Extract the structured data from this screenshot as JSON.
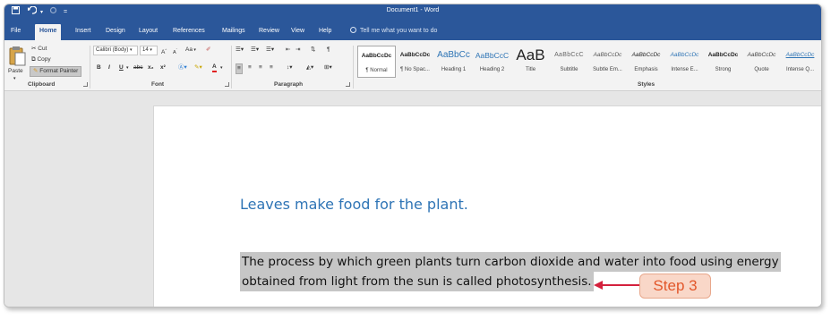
{
  "app": {
    "title": "Document1 - Word",
    "quick_access": {
      "save_icon": "save-icon",
      "undo_icon": "undo-icon",
      "redo_icon": "redo-icon",
      "customize_icon": "customize-icon"
    }
  },
  "tabs": [
    "File",
    "Home",
    "Insert",
    "Design",
    "Layout",
    "References",
    "Mailings",
    "Review",
    "View",
    "Help"
  ],
  "active_tab": "Home",
  "tell_me": "Tell me what you want to do",
  "ribbon": {
    "clipboard": {
      "label": "Clipboard",
      "paste": "Paste",
      "cut": "Cut",
      "copy": "Copy",
      "format_painter": "Format Painter"
    },
    "font": {
      "label": "Font",
      "font_name": "Calibri (Body)",
      "font_size": "14",
      "aa": "Aa",
      "buttons": [
        "B",
        "I",
        "U",
        "abc",
        "x₂",
        "x²"
      ]
    },
    "paragraph": {
      "label": "Paragraph"
    },
    "styles": {
      "label": "Styles",
      "items": [
        {
          "preview": "AaBbCcDc",
          "name": "¶ Normal"
        },
        {
          "preview": "AaBbCcDc",
          "name": "¶ No Spac..."
        },
        {
          "preview": "AaBbCc",
          "name": "Heading 1"
        },
        {
          "preview": "AaBbCcC",
          "name": "Heading 2"
        },
        {
          "preview": "AaB",
          "name": "Title"
        },
        {
          "preview": "AaBbCcC",
          "name": "Subtitle"
        },
        {
          "preview": "AaBbCcDc",
          "name": "Subtle Em..."
        },
        {
          "preview": "AaBbCcDc",
          "name": "Emphasis"
        },
        {
          "preview": "AaBbCcDc",
          "name": "Intense E..."
        },
        {
          "preview": "AaBbCcDc",
          "name": "Strong"
        },
        {
          "preview": "AaBbCcDc",
          "name": "Quote"
        },
        {
          "preview": "AaBbCcDc",
          "name": "Intense Q..."
        }
      ]
    }
  },
  "document": {
    "heading": "Leaves make food for the plant.",
    "para_line1": "The process by which green plants turn carbon dioxide and water into food using energy",
    "para_line2": "obtained from light from the sun is called photosynthesis."
  },
  "annotation": {
    "label": "Step 3"
  },
  "colors": {
    "brand": "#2b579a",
    "heading": "#2e74b5",
    "highlight": "#c6c6c6",
    "annotation": "#e2572b"
  }
}
